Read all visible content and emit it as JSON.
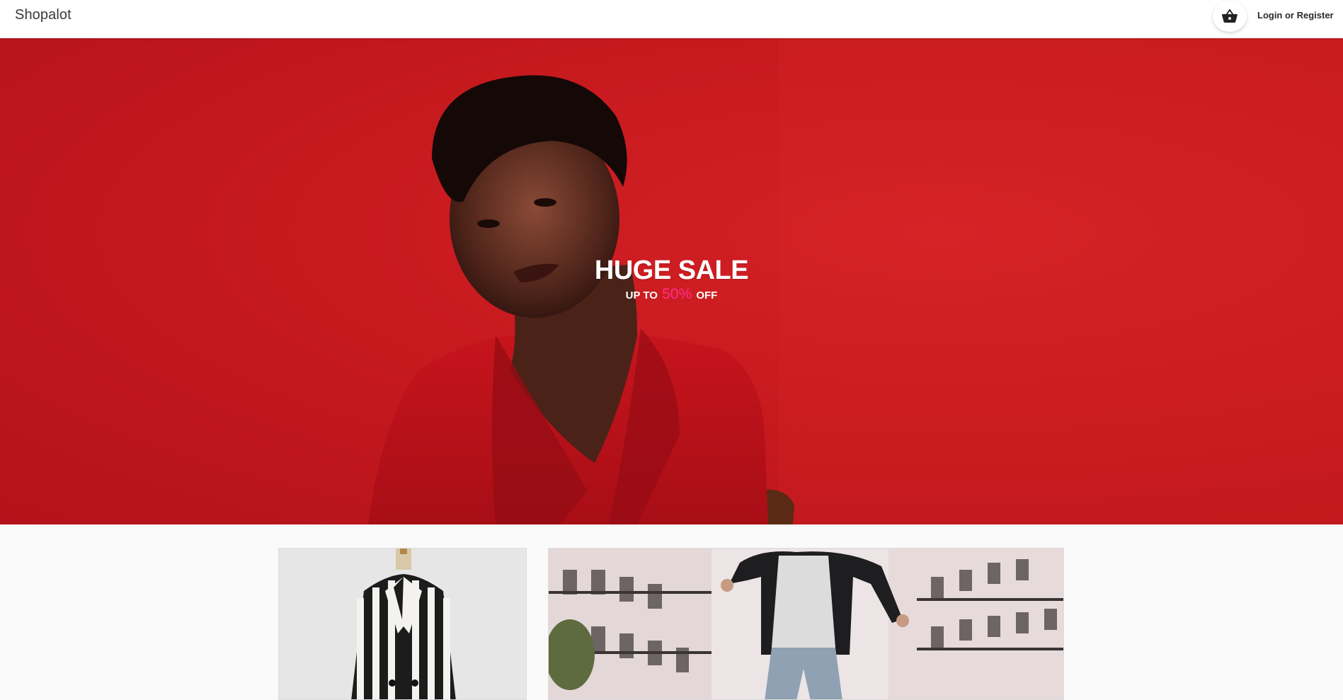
{
  "header": {
    "brand": "Shopalot",
    "cart_icon": "basket-icon",
    "login_label": "Login or Register"
  },
  "hero": {
    "title": "HUGE SALE",
    "subtitle_prefix": "UP TO",
    "subtitle_highlight": "50%",
    "subtitle_suffix": "OFF",
    "background_color": "#c71a1f",
    "highlight_color": "#ff2d87"
  },
  "tiles": [
    {
      "name": "striped-blazer"
    },
    {
      "name": "man-jumping-street"
    }
  ]
}
